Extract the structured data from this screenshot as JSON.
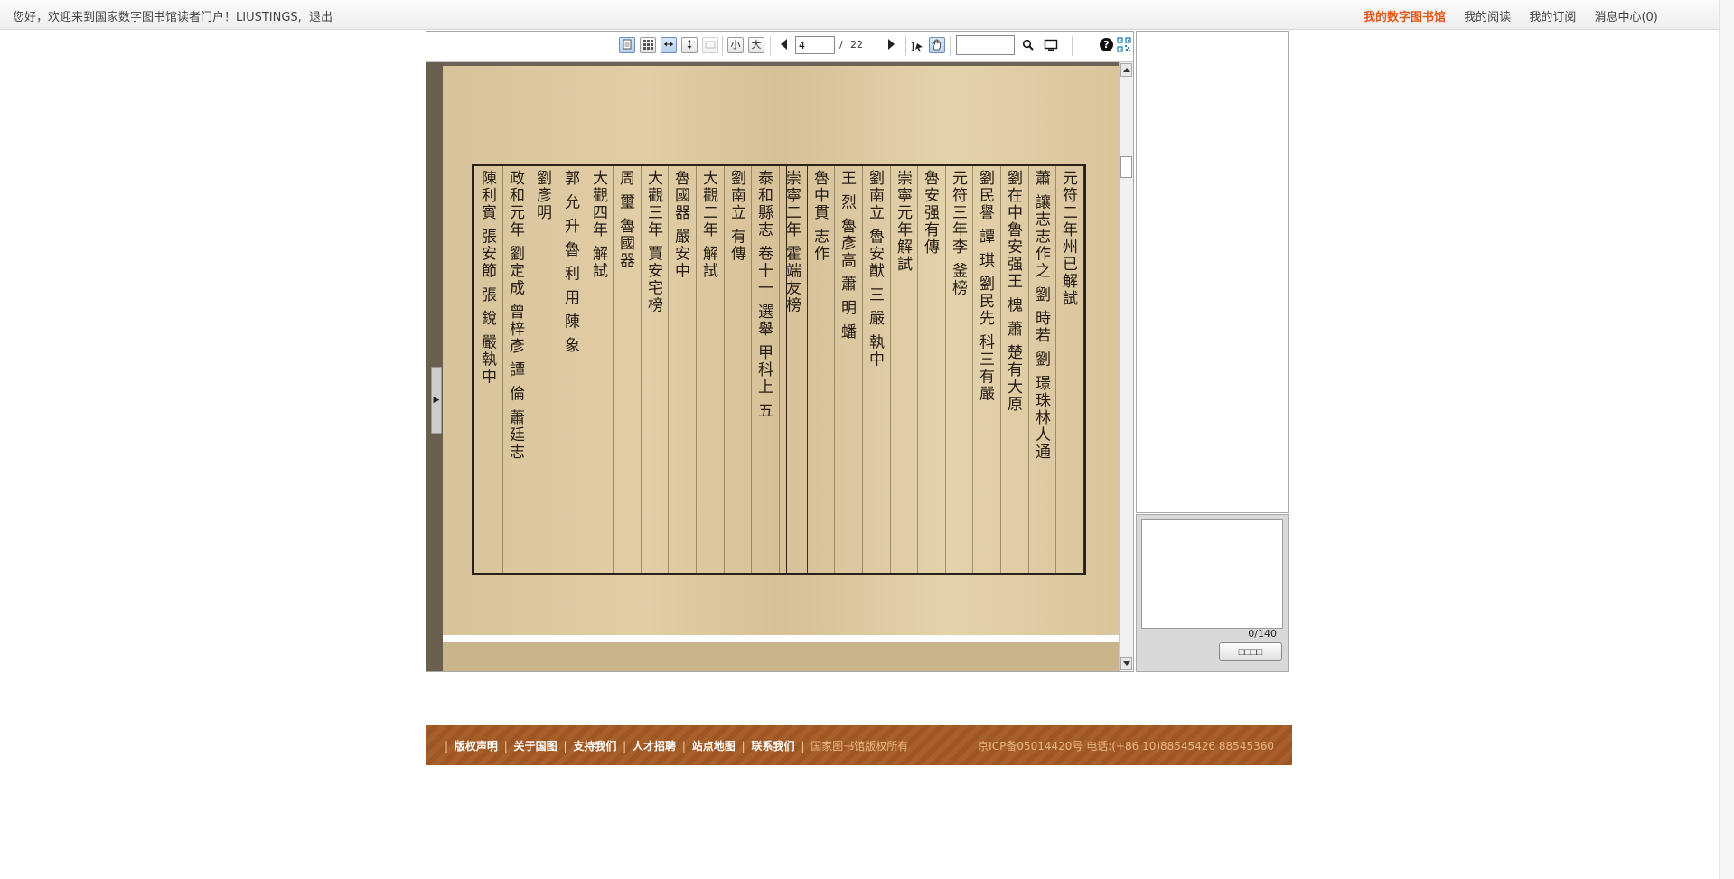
{
  "topbar": {
    "welcome": "您好，欢迎来到国家数字图书馆读者门户！LIUSTINGS,",
    "logout": "退出",
    "links": [
      "我的数字图书馆",
      "我的阅读",
      "我的订阅",
      "消息中心(0)"
    ]
  },
  "toolbar": {
    "zoom_small": "小",
    "zoom_large": "大",
    "page_current": "4",
    "page_slash": "/",
    "page_total": "22",
    "search_value": "",
    "help": "?"
  },
  "viewer": {
    "side_toggle": "▶",
    "columns": [
      "元符二年州已解試",
      "蕭 讓志志作之 劉 時若 劉 璟珠林人通",
      "劉在中魯安强王 槐 蕭 楚有大原",
      "劉民譽 譚 琪 劉民先 科三有嚴",
      "元符三年李 釜榜",
      "魯安强有傳",
      "崇寧元年解試",
      "劉南立 魯安猷 三 嚴 執中",
      "王 烈 魯彥高 蕭 明 蟠",
      "魯中貫 志作",
      "崇寧二年 霍端友榜",
      "泰和縣志 卷十一 選舉 甲科上 五",
      "劉南立 有傳",
      "大觀二年 解試",
      "魯國器 嚴安中",
      "大觀三年 賈安宅榜",
      "周 璽 魯國器",
      "大觀四年 解試",
      "郭 允 升 魯 利 用 陳 象",
      "劉彥明",
      "政和元年 劉定成 曾梓彥 譚 倫 蕭廷志",
      "陳利賓 張安節 張 銳 嚴執中"
    ]
  },
  "notes": {
    "count": "0/140",
    "submit": "□□□□"
  },
  "footer": {
    "links": [
      "版权声明",
      "关于国图",
      "支持我们",
      "人才招聘",
      "站点地图",
      "联系我们"
    ],
    "copyright": "国家图书馆版权所有",
    "icp": "京ICP备05014420号 电话:(+86 10)88545426 88545360"
  },
  "colors": {
    "brand_orange": "#e05a1a",
    "footer_brown": "#a8602b"
  }
}
